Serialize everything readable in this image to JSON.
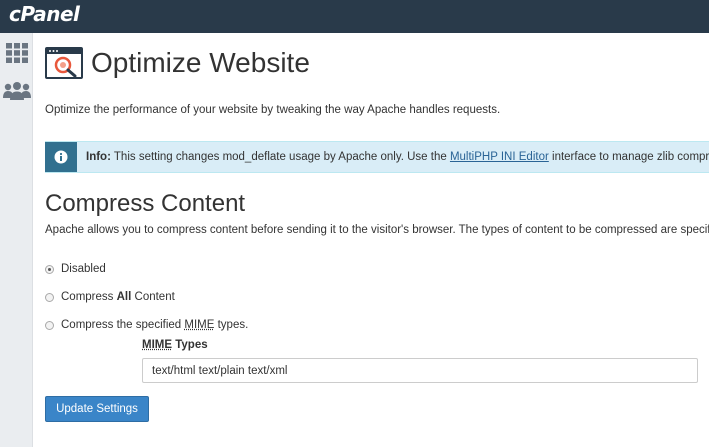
{
  "app": {
    "logo": "cPanel"
  },
  "sidebar": {
    "items": [
      {
        "name": "grid-icon"
      },
      {
        "name": "users-icon"
      }
    ]
  },
  "page": {
    "title": "Optimize Website",
    "description": "Optimize the performance of your website by tweaking the way Apache handles requests."
  },
  "info": {
    "label": "Info:",
    "text_before": " This setting changes mod_deflate usage by Apache only. Use the ",
    "link_text": "MultiPHP INI Editor",
    "text_after": " interface to manage zlib compression."
  },
  "compress": {
    "title": "Compress Content",
    "description": "Apache allows you to compress content before sending it to the visitor's browser. The types of content to be compressed are specified by MIME type."
  },
  "options": {
    "disabled": {
      "label": "Disabled",
      "checked": true
    },
    "all": {
      "prefix": "Compress ",
      "bold": "All",
      "suffix": " Content",
      "checked": false
    },
    "mime": {
      "prefix": "Compress the specified ",
      "abbr": "MIME",
      "suffix": " types.",
      "checked": false
    }
  },
  "mime_types": {
    "label_abbr": "MIME",
    "label_rest": " Types",
    "value": "text/html text/plain text/xml"
  },
  "actions": {
    "update_label": "Update Settings"
  },
  "colors": {
    "topbar": "#293a4a",
    "sidebar": "#eaedf0",
    "info_bg": "#d9edf7",
    "info_icon_bg": "#31708f",
    "primary": "#3a85c8",
    "link": "#2a6496"
  }
}
